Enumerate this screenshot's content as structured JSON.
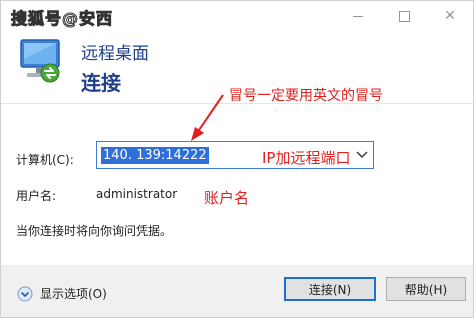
{
  "titlebar": {
    "watermark": "搜狐号@安西",
    "minimize_glyph": "—",
    "maximize_glyph": "☐",
    "close_glyph": "✕"
  },
  "header": {
    "subtitle": "远程桌面",
    "title": "连接",
    "icon": "remote-desktop-icon"
  },
  "form": {
    "computer_label": "计算机(C):",
    "computer_value": "140.          139:14222",
    "username_label": "用户名:",
    "username_value": "administrator",
    "info_text": "当你连接时将向你询问凭据。"
  },
  "annotations": {
    "colon_note": "冒号一定要用英文的冒号",
    "ip_note": "IP加远程端口",
    "user_note": "账户名",
    "color": "#e0201e"
  },
  "footer": {
    "options_label": "显示选项(O)",
    "connect_label": "连接(N)",
    "help_label": "帮助(H)"
  },
  "colors": {
    "title_blue": "#1f3e8c",
    "selection_blue": "#2f6fd8",
    "focus_border": "#3b7fd4"
  }
}
